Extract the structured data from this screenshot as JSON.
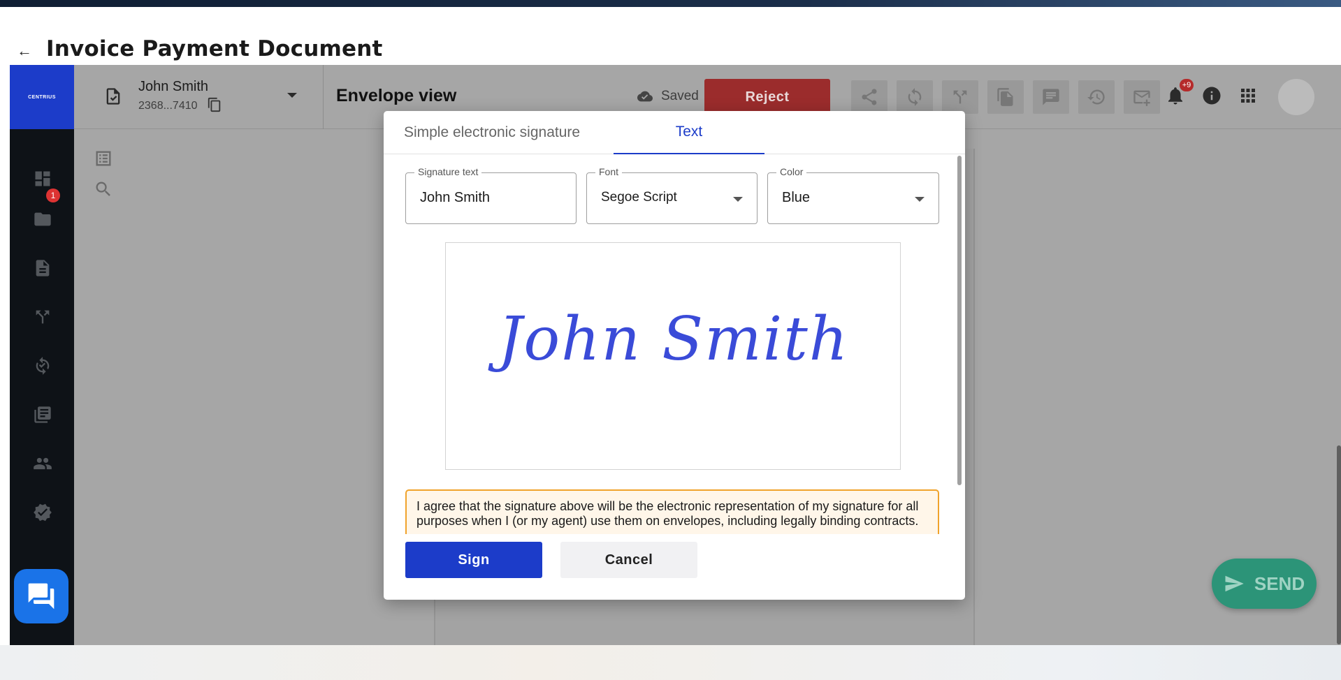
{
  "page": {
    "title": "Invoice Payment Document",
    "back_label": "←"
  },
  "brand": {
    "logo_text": "CENTRIUS"
  },
  "sidebar": {
    "items": [
      {
        "icon": "dashboard-icon"
      },
      {
        "icon": "folder-icon",
        "badge": "1"
      },
      {
        "icon": "document-icon"
      },
      {
        "icon": "workflow-icon"
      },
      {
        "icon": "sync-check-icon"
      },
      {
        "icon": "library-icon"
      },
      {
        "icon": "users-icon"
      },
      {
        "icon": "verified-icon"
      }
    ]
  },
  "topbar": {
    "user_name": "John Smith",
    "user_id": "2368...7410",
    "view_title": "Envelope view",
    "saved_label": "Saved",
    "reject_label": "Reject",
    "notification_badge": "+9"
  },
  "modal": {
    "tabs": [
      {
        "label": "Simple electronic signature",
        "active": false
      },
      {
        "label": "Text",
        "active": true
      }
    ],
    "fields": {
      "signature_text": {
        "label": "Signature text",
        "value": "John Smith"
      },
      "font": {
        "label": "Font",
        "value": "Segoe Script"
      },
      "color": {
        "label": "Color",
        "value": "Blue"
      }
    },
    "preview_text": "John Smith",
    "preview_color": "#3a4bd8",
    "agreement_text": "I agree that the signature above will be the electronic representation of my signature for all purposes when I (or my agent) use them on envelopes, including legally binding contracts.",
    "sign_label": "Sign",
    "cancel_label": "Cancel"
  },
  "send_label": "SEND",
  "colors": {
    "accent": "#1c3cc9",
    "reject": "#9b2c2c",
    "send": "#2c9478",
    "warning_border": "#f0a32c"
  }
}
